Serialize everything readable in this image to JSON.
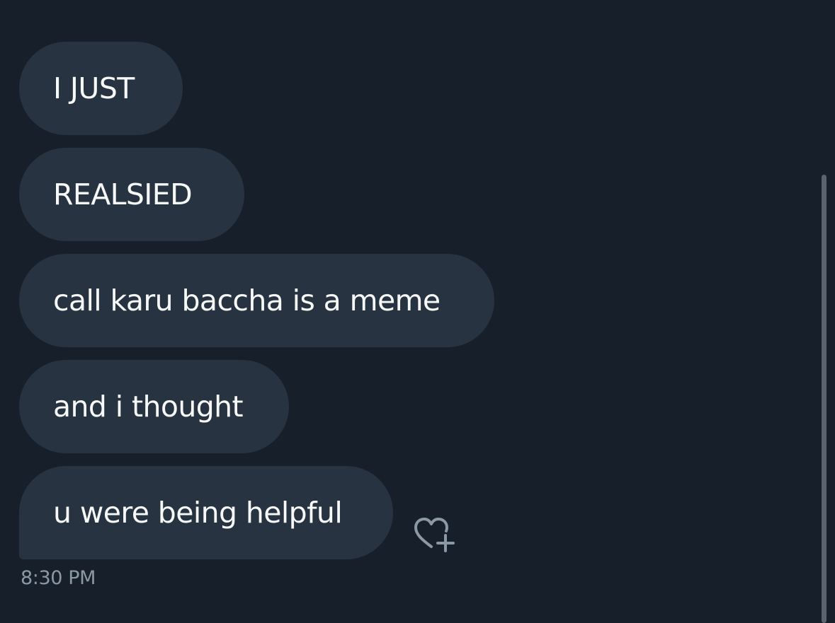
{
  "messages": [
    {
      "text": "I JUST"
    },
    {
      "text": "REALSIED"
    },
    {
      "text": "call karu baccha is a meme"
    },
    {
      "text": "and i thought"
    },
    {
      "text": "u were being helpful"
    }
  ],
  "timestamp": "8:30 PM",
  "icons": {
    "react": "heart-plus-icon"
  },
  "colors": {
    "background": "#17202a",
    "bubble": "#273340",
    "text": "#f7f9f9",
    "muted": "#8b98a5"
  }
}
